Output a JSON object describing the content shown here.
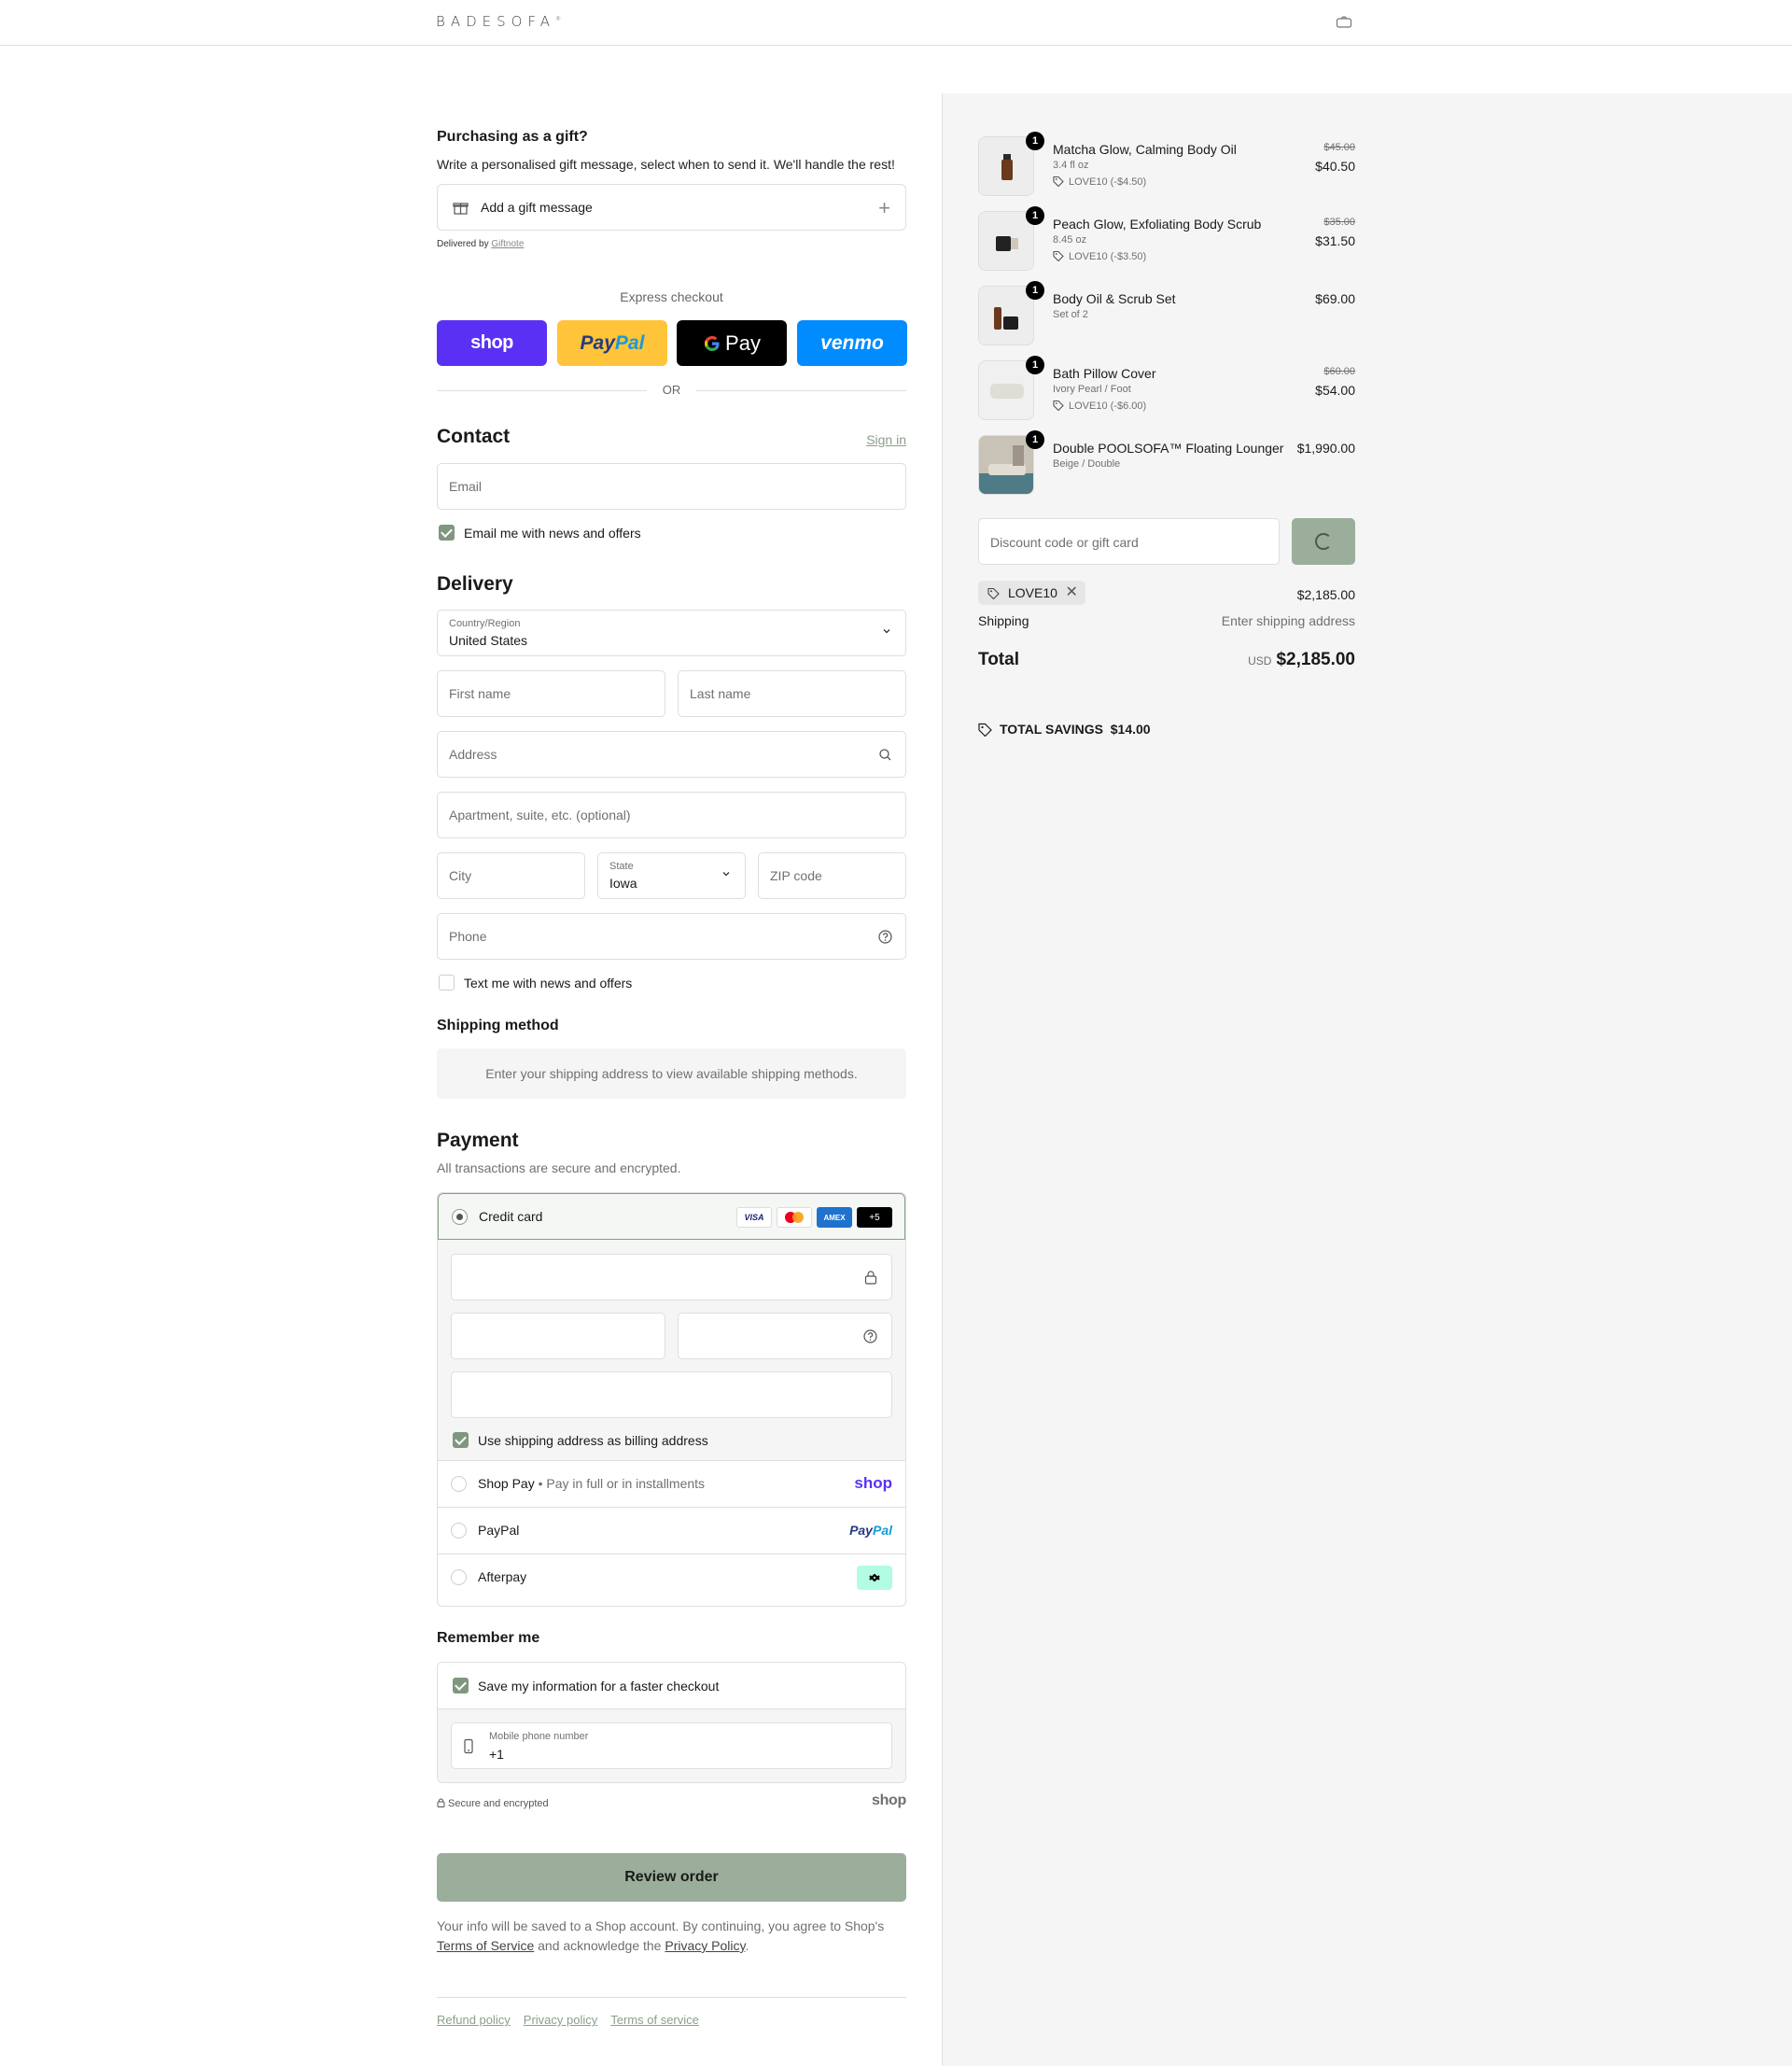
{
  "header": {
    "logo": "BADESOFA",
    "logo_mark": "®"
  },
  "gift": {
    "title": "Purchasing as a gift?",
    "description": "Write a personalised gift message, select when to send it. We'll handle the rest!",
    "add_label": "Add a gift message",
    "delivered_prefix": "Delivered by ",
    "delivered_link": "Giftnote"
  },
  "express": {
    "title": "Express checkout",
    "shop": "shop",
    "paypal_a": "Pay",
    "paypal_b": "Pal",
    "gpay": "Pay",
    "venmo": "venmo",
    "or": "OR"
  },
  "contact": {
    "title": "Contact",
    "sign_in": "Sign in",
    "email_placeholder": "Email",
    "news_label": "Email me with news and offers",
    "news_checked": true
  },
  "delivery": {
    "title": "Delivery",
    "country_label": "Country/Region",
    "country_value": "United States",
    "first_name": "First name",
    "last_name": "Last name",
    "address": "Address",
    "apartment": "Apartment, suite, etc. (optional)",
    "city": "City",
    "state_label": "State",
    "state_value": "Iowa",
    "zip": "ZIP code",
    "phone": "Phone",
    "text_label": "Text me with news and offers",
    "text_checked": false
  },
  "shipping_method": {
    "title": "Shipping method",
    "note": "Enter your shipping address to view available shipping methods."
  },
  "payment": {
    "title": "Payment",
    "subtitle": "All transactions are secure and encrypted.",
    "credit_card": "Credit card",
    "card_logos": [
      "VISA",
      "",
      "AMEX",
      "+5"
    ],
    "billing_label": "Use shipping address as billing address",
    "shop_pay": "Shop Pay",
    "shop_pay_sep": " • ",
    "shop_pay_sub": "Pay in full or in installments",
    "shop_pay_logo": "shop",
    "paypal": "PayPal",
    "paypal_logo_a": "Pay",
    "paypal_logo_b": "Pal",
    "afterpay": "Afterpay"
  },
  "remember": {
    "title": "Remember me",
    "save_label": "Save my information for a faster checkout",
    "phone_label": "Mobile phone number",
    "phone_value": "+1",
    "secure": "Secure and encrypted",
    "shop_logo": "shop"
  },
  "review_button": "Review order",
  "legal": {
    "text1": "Your info will be saved to a Shop account. By continuing, you agree to Shop's ",
    "tos": "Terms of Service",
    "text2": " and acknowledge the ",
    "privacy": "Privacy Policy",
    "text3": "."
  },
  "footer": {
    "links": [
      "Refund policy",
      "Privacy policy",
      "Terms of service"
    ]
  },
  "summary": {
    "items": [
      {
        "name": "Matcha Glow, Calming Body Oil",
        "variant": "3.4 fl oz",
        "discount": "LOVE10 (-$4.50)",
        "old_price": "$45.00",
        "price": "$40.50",
        "qty": "1"
      },
      {
        "name": "Peach Glow, Exfoliating Body Scrub",
        "variant": "8.45 oz",
        "discount": "LOVE10 (-$3.50)",
        "old_price": "$35.00",
        "price": "$31.50",
        "qty": "1"
      },
      {
        "name": "Body Oil & Scrub Set",
        "variant": "Set of 2",
        "discount": "",
        "old_price": "",
        "price": "$69.00",
        "qty": "1"
      },
      {
        "name": "Bath Pillow Cover",
        "variant": "Ivory Pearl / Foot",
        "discount": "LOVE10 (-$6.00)",
        "old_price": "$60.00",
        "price": "$54.00",
        "qty": "1"
      },
      {
        "name": "Double POOLSOFA™ Floating Lounger",
        "variant": "Beige / Double",
        "discount": "",
        "old_price": "",
        "price": "$1,990.00",
        "qty": "1"
      }
    ],
    "discount_placeholder": "Discount code or gift card",
    "applied_code": "LOVE10",
    "subtotal_value": "$2,185.00",
    "shipping_label": "Shipping",
    "shipping_value": "Enter shipping address",
    "total_label": "Total",
    "total_currency": "USD",
    "total_value": "$2,185.00",
    "savings_label": "TOTAL SAVINGS",
    "savings_value": "$14.00"
  },
  "colors": {
    "accent": "#9bae9b",
    "check": "#7f977f",
    "shop_purple": "#5a31f4",
    "paypal_yellow": "#ffc439",
    "venmo_blue": "#008cff",
    "panel_bg": "#f5f5f5"
  }
}
